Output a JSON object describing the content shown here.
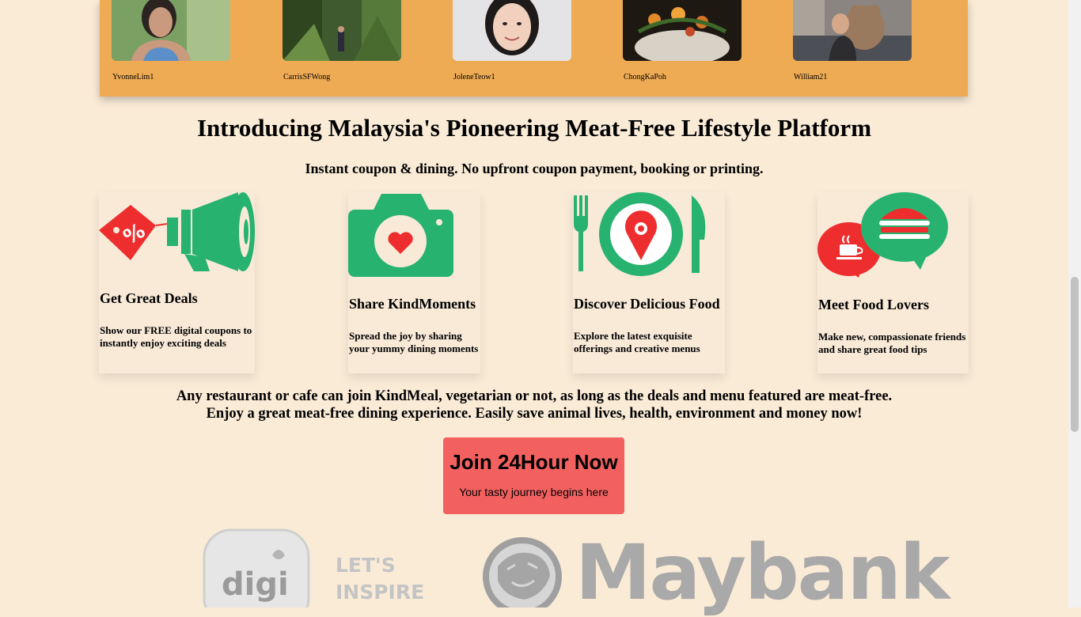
{
  "members": [
    {
      "name": "YvonneLim1"
    },
    {
      "name": "CarrisSFWong"
    },
    {
      "name": "JoleneTeow1"
    },
    {
      "name": "ChongKaPoh"
    },
    {
      "name": "William21"
    }
  ],
  "intro": {
    "title": "Introducing Malaysia's Pioneering Meat-Free Lifestyle Platform",
    "subtitle": "Instant coupon & dining. No upfront coupon payment, booking or printing."
  },
  "features": [
    {
      "title": "Get Great Deals",
      "desc": "Show our FREE digital coupons to instantly enjoy exciting deals"
    },
    {
      "title": "Share KindMoments",
      "desc": "Spread the joy by sharing your yummy dining moments"
    },
    {
      "title": "Discover Delicious Food",
      "desc": "Explore the latest exquisite offerings and creative menus"
    },
    {
      "title": "Meet Food Lovers",
      "desc": "Make new, compassionate friends and share great food tips"
    }
  ],
  "tagline": {
    "line1": "Any restaurant or cafe can join KindMeal, vegetarian or not, as long as the deals and menu featured are meat-free.",
    "line2": "Enjoy a great meat-free dining experience. Easily save animal lives, health, environment and money now!"
  },
  "cta": {
    "title": "Join 24Hour Now",
    "subtitle": "Your tasty journey begins here"
  },
  "sponsors": {
    "digi_word": "digi",
    "digi_line1": "LET'S",
    "digi_line2": "INSPIRE",
    "maybank_word": "Maybank"
  },
  "colors": {
    "green": "#27b36f",
    "red": "#ee2e2e",
    "strip": "#eeab54",
    "cta": "#f26160"
  }
}
